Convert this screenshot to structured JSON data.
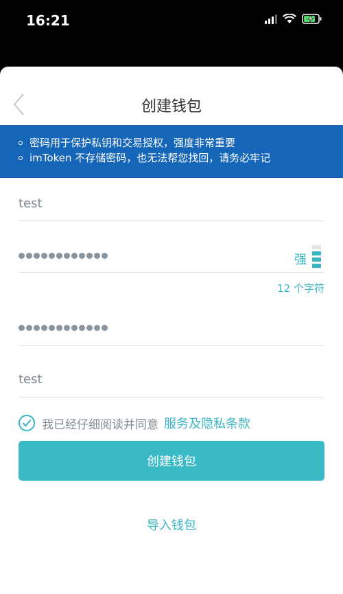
{
  "status_bar": {
    "time": "16:21"
  },
  "nav": {
    "title": "创建钱包",
    "back_icon": "chevron-left-icon"
  },
  "notice": {
    "items": [
      "密码用于保护私钥和交易授权，强度非常重要",
      "imToken 不存储密码，也无法帮您找回，请务必牢记"
    ],
    "background_color": "#1565b8"
  },
  "form": {
    "wallet_name": "test",
    "password_masked": "●●●●●●●●●●●●",
    "password_strength_label": "强",
    "password_strength_level": 3,
    "password_strength_max": 4,
    "char_count": "12 个字符",
    "confirm_password_masked": "●●●●●●●●●●●●",
    "password_hint": "test"
  },
  "agreement": {
    "checked": true,
    "text": "我已经仔细阅读并同意",
    "link": "服务及隐私条款"
  },
  "buttons": {
    "create": "创建钱包",
    "import": "导入钱包"
  },
  "colors": {
    "accent": "#3ab9c7",
    "banner": "#1565b8"
  }
}
